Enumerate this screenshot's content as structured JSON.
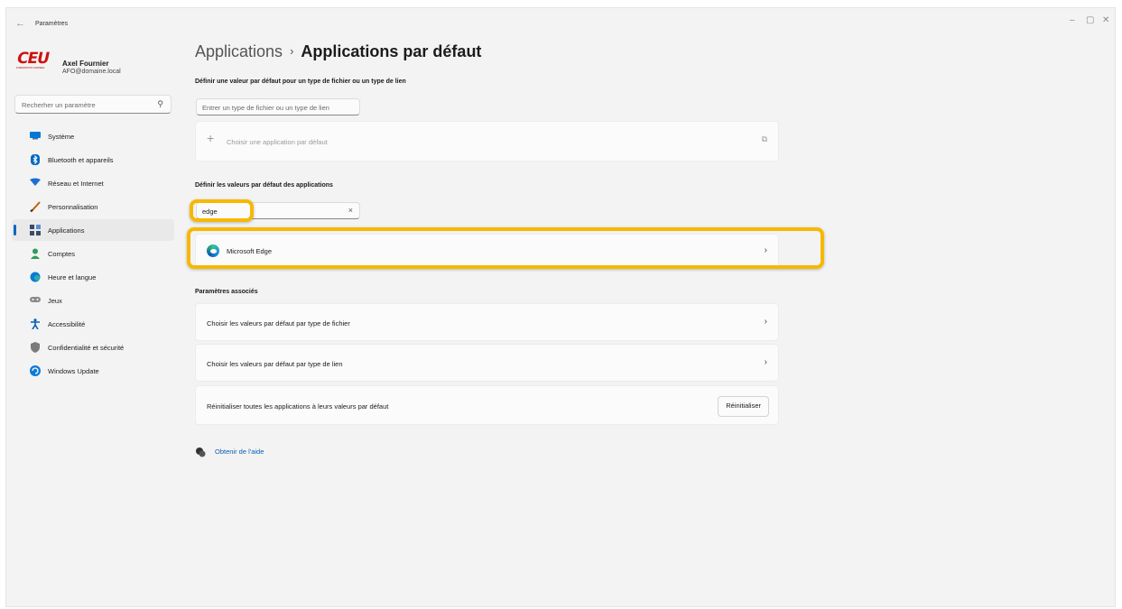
{
  "window": {
    "app_title": "Paramètres"
  },
  "profile": {
    "logo_text": "CEU",
    "logo_subtext": "FORMATION CONSEIL",
    "name": "Axel Fournier",
    "email": "AFO@domaine.local"
  },
  "search": {
    "placeholder": "Recherher un paramètre"
  },
  "sidebar": {
    "items": [
      {
        "label": "Système",
        "icon": "monitor-icon",
        "color": "#0078d4"
      },
      {
        "label": "Bluetooth et appareils",
        "icon": "bluetooth-icon",
        "color": "#0067c0"
      },
      {
        "label": "Réseau et Internet",
        "icon": "wifi-icon",
        "color": "#1a6fd1"
      },
      {
        "label": "Personnalisation",
        "icon": "brush-icon",
        "color": "#c06000"
      },
      {
        "label": "Applications",
        "icon": "apps-icon",
        "color": "#3a4a6b",
        "active": true
      },
      {
        "label": "Comptes",
        "icon": "person-icon",
        "color": "#2e9d5b"
      },
      {
        "label": "Heure et langue",
        "icon": "globe-clock-icon",
        "color": "#0a7bd6"
      },
      {
        "label": "Jeux",
        "icon": "gamepad-icon",
        "color": "#7a7a7a"
      },
      {
        "label": "Accessibilité",
        "icon": "accessibility-icon",
        "color": "#0a5fb4"
      },
      {
        "label": "Confidentialité et sécurité",
        "icon": "shield-icon",
        "color": "#6e6e6e"
      },
      {
        "label": "Windows Update",
        "icon": "update-icon",
        "color": "#0a7bd6"
      }
    ]
  },
  "breadcrumb": {
    "parent": "Applications",
    "separator": "›",
    "current": "Applications par défaut"
  },
  "file_type": {
    "heading": "Définir une valeur par défaut pour un type de fichier ou un type de lien",
    "input_placeholder": "Entrer un type de fichier ou un type de lien",
    "choose_label": "Choisir une application par défaut"
  },
  "app_defaults": {
    "heading": "Définir les valeurs par défaut des applications",
    "search_value": "edge",
    "clear_glyph": "×",
    "result_label": "Microsoft Edge"
  },
  "related": {
    "heading": "Paramètres associés",
    "file_type_label": "Choisir les valeurs par défaut par type de fichier",
    "link_type_label": "Choisir les valeurs par défaut par type de lien",
    "reset_label": "Réinitialiser toutes les applications à leurs valeurs par défaut",
    "reset_button": "Réinitialiser"
  },
  "help": {
    "label": "Obtenir de l'aide"
  },
  "highlight_color": "#f6b800"
}
